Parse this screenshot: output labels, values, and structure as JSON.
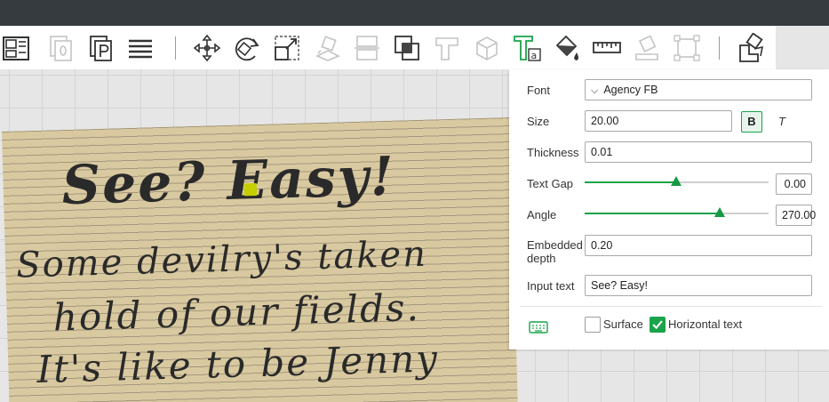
{
  "toolbar": {
    "tools": [
      "layout-icon",
      "plate-stack-icon",
      "plate-p-icon",
      "list-icon",
      "move-icon",
      "rotate-icon",
      "scale-icon",
      "place-on-face-icon",
      "cut-icon",
      "boolean-icon",
      "support-icon",
      "cube-icon",
      "text-tool-icon",
      "paint-bucket-icon",
      "measure-ruler-icon",
      "eraser-icon",
      "frame-icon",
      "assembly-icon"
    ],
    "active_tool": "text-tool-icon",
    "accent": "#1aa34a"
  },
  "canvas": {
    "lines": [
      "See? Easy!",
      "Some devilry's taken",
      "hold of our fields.",
      "It's like to be Jenny"
    ],
    "plate_color": "#d9c9a0",
    "text_color": "#2a2a2a",
    "marker_color": "#c5cf00"
  },
  "panel": {
    "font": {
      "label": "Font",
      "value": "Agency FB",
      "chevron": "⌵"
    },
    "size": {
      "label": "Size",
      "value": "20.00",
      "bold": "B",
      "italic": "T"
    },
    "thickness": {
      "label": "Thickness",
      "value": "0.01"
    },
    "text_gap": {
      "label": "Text Gap",
      "value": "0.00",
      "slider_fraction": 0.5
    },
    "angle": {
      "label": "Angle",
      "value": "270.00",
      "slider_fraction": 0.75
    },
    "embedded_depth": {
      "label_line1": "Embedded",
      "label_line2": "depth",
      "value": "0.20"
    },
    "input_text": {
      "label": "Input text",
      "value": "See? Easy!"
    },
    "surface": {
      "label": "Surface",
      "checked": false
    },
    "horizontal_text": {
      "label": "Horizontal text",
      "checked": true
    }
  }
}
